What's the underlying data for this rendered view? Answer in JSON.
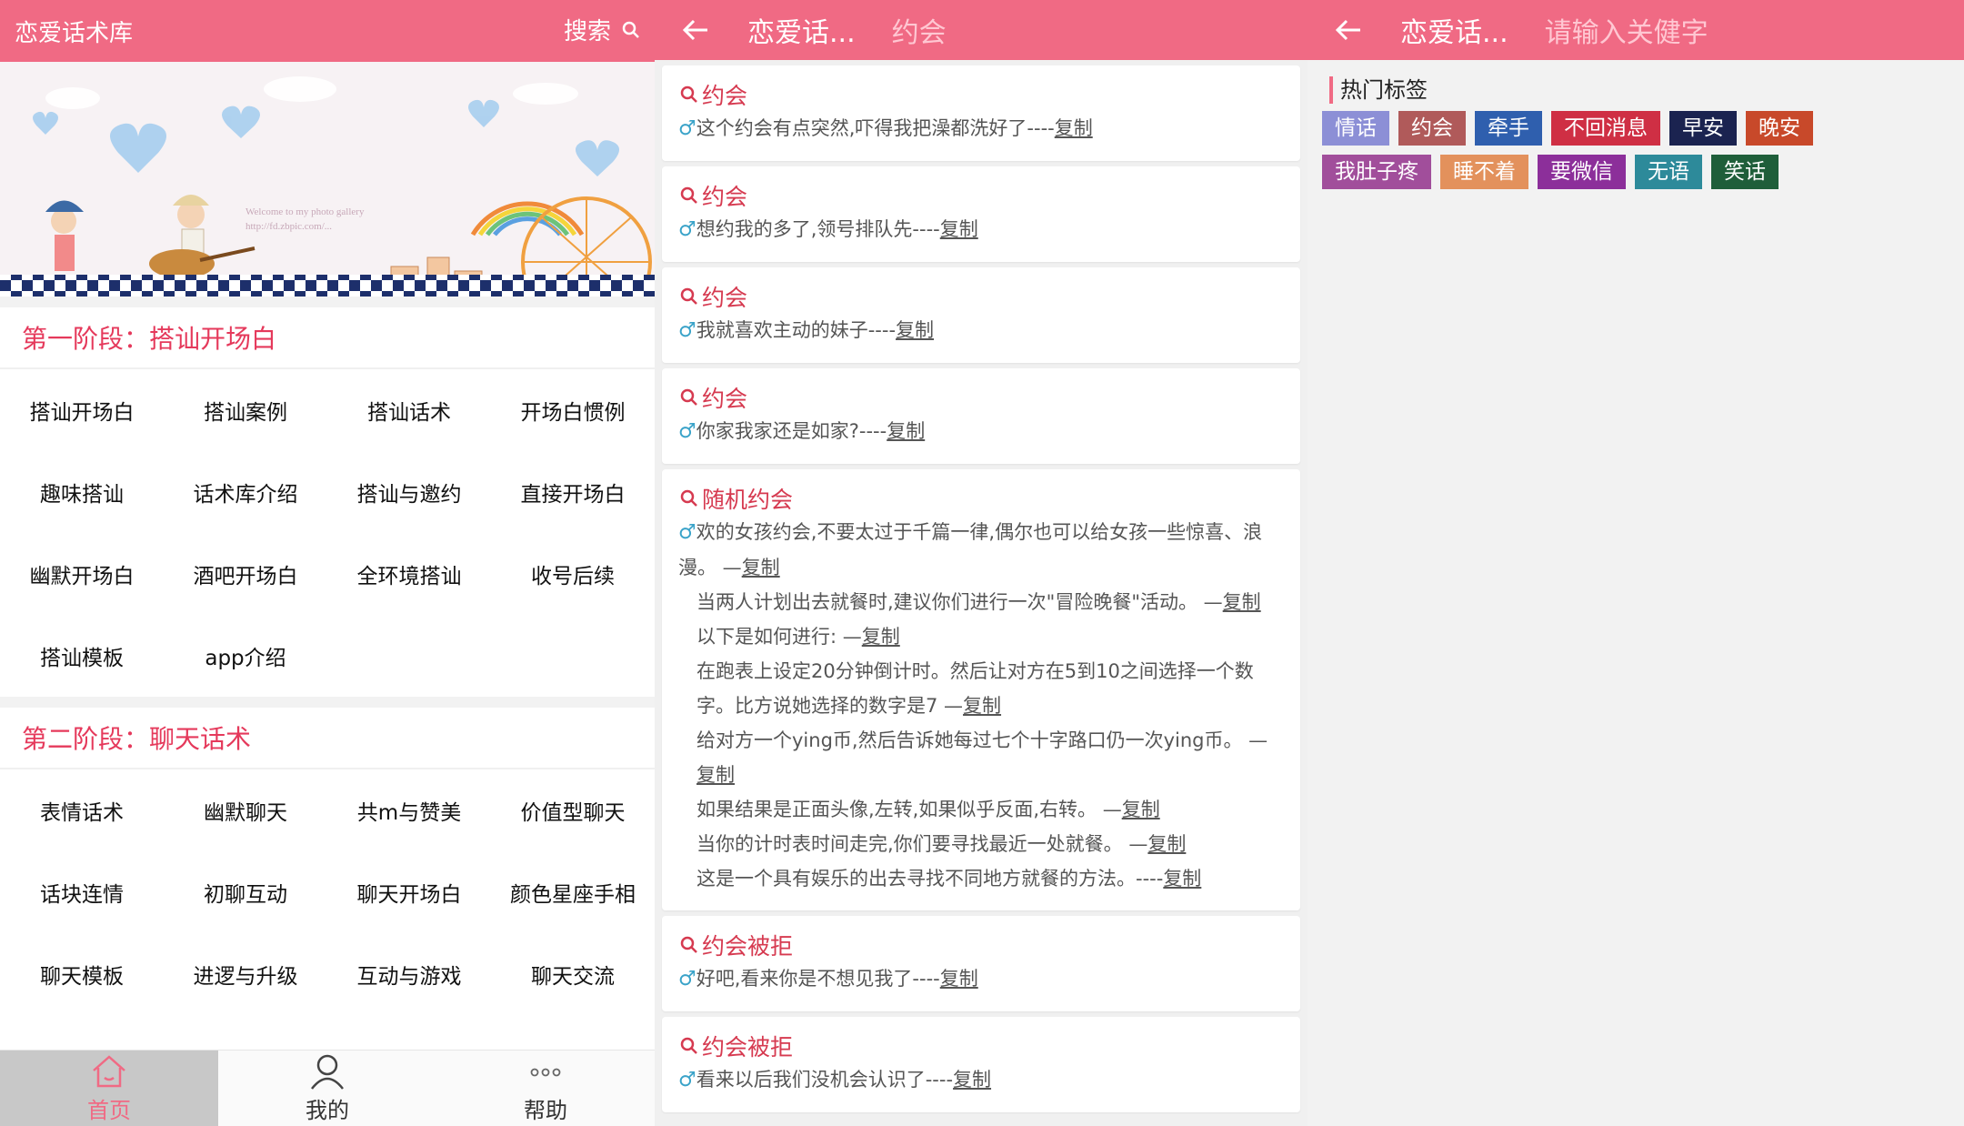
{
  "screen1": {
    "title": "恋爱话术库",
    "search_label": "搜索",
    "section1_title": "第一阶段：搭讪开场白",
    "section1_items": [
      "搭讪开场白",
      "搭讪案例",
      "搭讪话术",
      "开场白惯例",
      "趣味搭讪",
      "话术库介绍",
      "搭讪与邀约",
      "直接开场白",
      "幽默开场白",
      "酒吧开场白",
      "全环境搭讪",
      "收号后续",
      "搭讪模板",
      "app介绍"
    ],
    "section2_title": "第二阶段：聊天话术",
    "section2_items": [
      "表情话术",
      "幽默聊天",
      "共m与赞美",
      "价值型聊天",
      "话块连情",
      "初聊互动",
      "聊天开场白",
      "颜色星座手相",
      "聊天模板",
      "进逻与升级",
      "互动与游戏",
      "聊天交流"
    ],
    "nav": [
      {
        "label": "首页",
        "icon": "home-icon"
      },
      {
        "label": "我的",
        "icon": "user-icon"
      },
      {
        "label": "帮助",
        "icon": "more-icon"
      }
    ],
    "banner_text": "Welcome to my photo gallery",
    "banner_url": "http://fd.zbpic.com/..."
  },
  "screen2": {
    "title": "恋爱话...",
    "subtitle": "约会",
    "male_symbol": "♂",
    "copy_label": "复制",
    "cards": [
      {
        "title": "约会",
        "lines": [
          "这个约会有点突然,吓得我把澡都洗好了----"
        ]
      },
      {
        "title": "约会",
        "lines": [
          "想约我的多了,领号排队先----"
        ]
      },
      {
        "title": "约会",
        "lines": [
          "我就喜欢主动的妹子----"
        ]
      },
      {
        "title": "约会",
        "lines": [
          "你家我家还是如家?----"
        ]
      },
      {
        "title": "随机约会",
        "lines": [
          "欢的女孩约会,不要太过于千篇一律,偶尔也可以给女孩一些惊喜、浪漫。 —",
          "当两人计划出去就餐时,建议你们进行一次\"冒险晚餐\"活动。 —",
          "以下是如何进行: —",
          "在跑表上设定20分钟倒计时。然后让对方在5到10之间选择一个数字。比方说她选择的数字是7 —",
          "给对方一个ying币,然后告诉她每过七个十字路口仍一次ying币。 —",
          "如果结果是正面头像,左转,如果似乎反面,右转。 —",
          "当你的计时表时间走完,你们要寻找最近一处就餐。 —",
          "这是一个具有娱乐的出去寻找不同地方就餐的方法。----"
        ]
      },
      {
        "title": "约会被拒",
        "lines": [
          "好吧,看来你是不想见我了----"
        ]
      },
      {
        "title": "约会被拒",
        "lines": [
          "看来以后我们没机会认识了----"
        ]
      }
    ]
  },
  "screen3": {
    "title": "恋爱话...",
    "search_placeholder": "请输入关健字",
    "hot_tags_title": "热门标签",
    "tags": [
      {
        "label": "情话",
        "color": "#8c8fd6"
      },
      {
        "label": "约会",
        "color": "#b05a5a"
      },
      {
        "label": "牵手",
        "color": "#2f5fae"
      },
      {
        "label": "不回消息",
        "color": "#cf2f44"
      },
      {
        "label": "早安",
        "color": "#1b2350"
      },
      {
        "label": "晚安",
        "color": "#c8492a"
      },
      {
        "label": "我肚子疼",
        "color": "#a14e9b"
      },
      {
        "label": "睡不着",
        "color": "#e3915c"
      },
      {
        "label": "要微信",
        "color": "#8c2f9a"
      },
      {
        "label": "无语",
        "color": "#2d8a9a"
      },
      {
        "label": "笑话",
        "color": "#1f5e3a"
      }
    ]
  },
  "colors": {
    "accent": "#f06a84",
    "title_red": "#e5395b"
  }
}
